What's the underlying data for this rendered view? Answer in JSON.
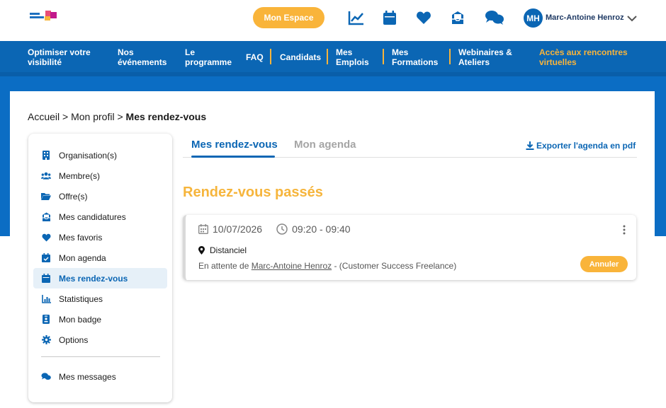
{
  "header": {
    "espace_label": "Mon Espace",
    "avatar_initials": "MH",
    "user_name": "Marc-Antoine Henroz"
  },
  "nav": {
    "items": [
      {
        "label": "Optimiser votre visibilité"
      },
      {
        "label": "Nos événements"
      },
      {
        "label": "Le programme"
      },
      {
        "label": "FAQ"
      },
      {
        "label": "Candidats"
      },
      {
        "label": "Mes Emplois"
      },
      {
        "label": "Mes Formations"
      },
      {
        "label": "Webinaires & Ateliers"
      },
      {
        "label": "Accès aux rencontres virtuelles"
      }
    ]
  },
  "breadcrumb": {
    "home": "Accueil",
    "sep1": ">",
    "profile": "Mon profil",
    "sep2": ">",
    "current": "Mes rendez-vous"
  },
  "sidebar": {
    "items": [
      {
        "label": "Organisation(s)",
        "icon": "building-icon"
      },
      {
        "label": "Membre(s)",
        "icon": "users-icon"
      },
      {
        "label": "Offre(s)",
        "icon": "folder-icon"
      },
      {
        "label": "Mes candidatures",
        "icon": "inbox-icon"
      },
      {
        "label": "Mes favoris",
        "icon": "heart-icon"
      },
      {
        "label": "Mon agenda",
        "icon": "calendar-check-icon"
      },
      {
        "label": "Mes rendez-vous",
        "icon": "calendar-icon",
        "active": true
      },
      {
        "label": "Statistiques",
        "icon": "chart-icon"
      },
      {
        "label": "Mon badge",
        "icon": "badge-icon"
      },
      {
        "label": "Options",
        "icon": "gear-icon"
      }
    ],
    "messages_label": "Mes messages"
  },
  "tabs": {
    "active": "Mes rendez-vous",
    "inactive": "Mon agenda",
    "export": "Exporter l'agenda en pdf"
  },
  "section_title": "Rendez-vous passés",
  "appointment": {
    "date": "10/07/2026",
    "time": "09:20 - 09:40",
    "location": "Distanciel",
    "status_prefix": "En attente de",
    "status_person": "Marc-Antoine Henroz",
    "status_suffix": "- (Customer Success Freelance)",
    "cancel_label": "Annuler"
  },
  "colors": {
    "primary": "#0b66b4",
    "accent": "#f9b43a",
    "title": "#f6b53c"
  }
}
